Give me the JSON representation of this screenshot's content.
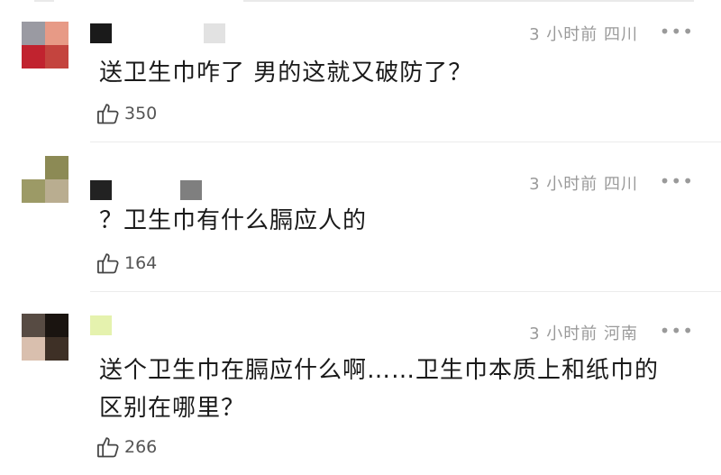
{
  "comments": [
    {
      "time": "3 小时前",
      "location": "四川",
      "more": "•••",
      "text_lines": [
        "送卫生巾咋了 男的这就又破防了？"
      ],
      "likes": "350",
      "avatar_colors": [
        "#9a9aa2",
        "#e79a86",
        "#c1232f",
        "#c4443e"
      ],
      "nick_colors": [
        "#1a1a1a",
        "#e2e2e2"
      ]
    },
    {
      "time": "3 小时前",
      "location": "四川",
      "more": "•••",
      "text_lines": [
        "？卫生巾有什么膈应人的"
      ],
      "likes": "164",
      "avatar_colors": [
        "#ffffff",
        "#8c8a55",
        "#9c9a66",
        "#b9ad90"
      ],
      "nick_colors": [
        "#222222",
        "#7f7f7f"
      ]
    },
    {
      "time": "3 小时前",
      "location": "河南",
      "more": "•••",
      "text_lines": [
        "送个卫生巾在膈应什么啊……卫生巾本质上和纸巾的",
        "区别在哪里？"
      ],
      "likes": "266",
      "avatar_colors": [
        "#574b43",
        "#1a1410",
        "#d9bfae",
        "#3e3026"
      ],
      "nick_colors": [
        "#e5f2ae"
      ]
    }
  ]
}
